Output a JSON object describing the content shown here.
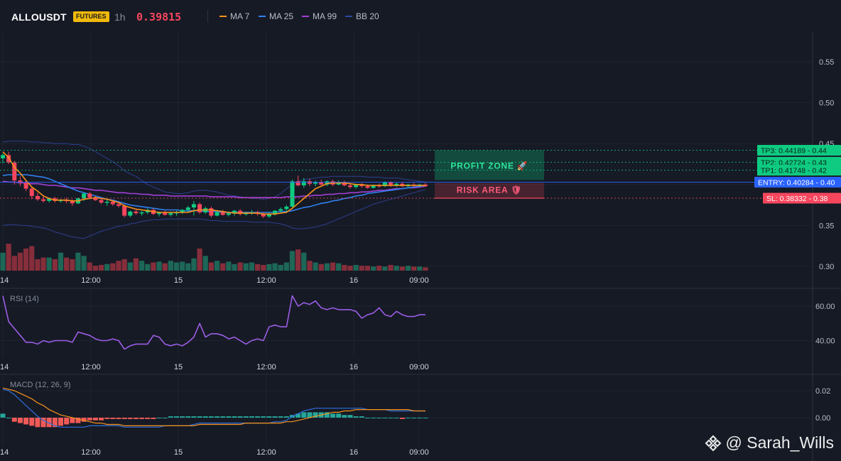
{
  "header": {
    "symbol": "ALLOUSDT",
    "badge": "FUTURES",
    "interval": "1h",
    "price": "0.39815"
  },
  "legend": [
    {
      "label": "MA 7",
      "color": "#f7931a"
    },
    {
      "label": "MA 25",
      "color": "#2f80ed"
    },
    {
      "label": "MA 99",
      "color": "#a23fd6"
    },
    {
      "label": "BB 20",
      "color": "#2d4aa0"
    }
  ],
  "price_axis": {
    "ticks": [
      "0.55",
      "0.50",
      "0.45",
      "0.40",
      "0.35",
      "0.30"
    ]
  },
  "time_axis": {
    "labels": [
      "14",
      "12:00",
      "15",
      "12:00",
      "16",
      "09:00"
    ]
  },
  "levels": [
    {
      "name": "TP3",
      "text": "TP3: 0.44189",
      "axis": "0.44",
      "value": 0.44189,
      "color": "#0ecb81"
    },
    {
      "name": "TP2",
      "text": "TP2: 0.42724",
      "axis": "0.43",
      "value": 0.42724,
      "color": "#0ecb81"
    },
    {
      "name": "TP1",
      "text": "TP1: 0.41748",
      "axis": "0.42",
      "value": 0.41748,
      "color": "#0ecb81"
    },
    {
      "name": "ENTRY",
      "text": "ENTRY: 0.40284",
      "axis": "0.40",
      "value": 0.40284,
      "color": "#2962ff"
    },
    {
      "name": "SL",
      "text": "SL: 0.38332",
      "axis": "0.38",
      "value": 0.38332,
      "color": "#f6465d"
    }
  ],
  "zones": {
    "profit": "PROFIT ZONE 🚀",
    "risk": "RISK AREA 🛡"
  },
  "rsi": {
    "title": "RSI (14)",
    "ticks": [
      "60.00",
      "40.00"
    ]
  },
  "macd": {
    "title": "MACD (12, 26, 9)",
    "ticks": [
      "0.02",
      "0.00"
    ]
  },
  "watermark": "@ Sarah_Wills",
  "colors": {
    "up": "#0ecb81",
    "down": "#f6465d"
  },
  "chart_data": {
    "type": "candlestick",
    "candles": [
      [
        0.432,
        0.438,
        0.426,
        0.436
      ],
      [
        0.436,
        0.44,
        0.425,
        0.427
      ],
      [
        0.427,
        0.429,
        0.4,
        0.405
      ],
      [
        0.405,
        0.41,
        0.398,
        0.402
      ],
      [
        0.402,
        0.405,
        0.392,
        0.395
      ],
      [
        0.395,
        0.397,
        0.382,
        0.386
      ],
      [
        0.386,
        0.39,
        0.38,
        0.382
      ],
      [
        0.382,
        0.385,
        0.378,
        0.38
      ],
      [
        0.38,
        0.384,
        0.378,
        0.383
      ],
      [
        0.383,
        0.385,
        0.378,
        0.38
      ],
      [
        0.38,
        0.382,
        0.378,
        0.381
      ],
      [
        0.381,
        0.384,
        0.377,
        0.38
      ],
      [
        0.38,
        0.382,
        0.374,
        0.377
      ],
      [
        0.377,
        0.384,
        0.376,
        0.383
      ],
      [
        0.383,
        0.39,
        0.38,
        0.389
      ],
      [
        0.389,
        0.391,
        0.383,
        0.384
      ],
      [
        0.384,
        0.386,
        0.38,
        0.381
      ],
      [
        0.381,
        0.383,
        0.376,
        0.378
      ],
      [
        0.378,
        0.382,
        0.374,
        0.379
      ],
      [
        0.379,
        0.381,
        0.374,
        0.376
      ],
      [
        0.376,
        0.378,
        0.372,
        0.374
      ],
      [
        0.374,
        0.376,
        0.36,
        0.362
      ],
      [
        0.362,
        0.368,
        0.36,
        0.367
      ],
      [
        0.367,
        0.369,
        0.363,
        0.365
      ],
      [
        0.365,
        0.368,
        0.362,
        0.366
      ],
      [
        0.366,
        0.371,
        0.364,
        0.369
      ],
      [
        0.369,
        0.371,
        0.363,
        0.364
      ],
      [
        0.364,
        0.367,
        0.361,
        0.366
      ],
      [
        0.366,
        0.368,
        0.362,
        0.363
      ],
      [
        0.363,
        0.367,
        0.361,
        0.365
      ],
      [
        0.365,
        0.368,
        0.362,
        0.366
      ],
      [
        0.366,
        0.37,
        0.364,
        0.369
      ],
      [
        0.369,
        0.374,
        0.366,
        0.372
      ],
      [
        0.372,
        0.38,
        0.362,
        0.376
      ],
      [
        0.376,
        0.378,
        0.364,
        0.366
      ],
      [
        0.366,
        0.373,
        0.364,
        0.371
      ],
      [
        0.371,
        0.373,
        0.36,
        0.362
      ],
      [
        0.362,
        0.368,
        0.361,
        0.366
      ],
      [
        0.366,
        0.369,
        0.362,
        0.363
      ],
      [
        0.363,
        0.367,
        0.361,
        0.365
      ],
      [
        0.365,
        0.369,
        0.362,
        0.368
      ],
      [
        0.368,
        0.37,
        0.362,
        0.364
      ],
      [
        0.364,
        0.367,
        0.362,
        0.365
      ],
      [
        0.365,
        0.369,
        0.363,
        0.366
      ],
      [
        0.366,
        0.368,
        0.362,
        0.364
      ],
      [
        0.364,
        0.366,
        0.359,
        0.361
      ],
      [
        0.361,
        0.366,
        0.359,
        0.364
      ],
      [
        0.364,
        0.369,
        0.362,
        0.368
      ],
      [
        0.368,
        0.372,
        0.366,
        0.37
      ],
      [
        0.37,
        0.375,
        0.367,
        0.373
      ],
      [
        0.373,
        0.406,
        0.372,
        0.404
      ],
      [
        0.404,
        0.411,
        0.398,
        0.399
      ],
      [
        0.399,
        0.408,
        0.396,
        0.404
      ],
      [
        0.404,
        0.407,
        0.398,
        0.401
      ],
      [
        0.401,
        0.405,
        0.398,
        0.403
      ],
      [
        0.403,
        0.406,
        0.399,
        0.4
      ],
      [
        0.4,
        0.405,
        0.398,
        0.404
      ],
      [
        0.404,
        0.406,
        0.398,
        0.4
      ],
      [
        0.4,
        0.405,
        0.399,
        0.403
      ],
      [
        0.403,
        0.405,
        0.398,
        0.399
      ],
      [
        0.399,
        0.402,
        0.395,
        0.397
      ],
      [
        0.397,
        0.401,
        0.395,
        0.4
      ],
      [
        0.4,
        0.402,
        0.396,
        0.398
      ],
      [
        0.398,
        0.4,
        0.395,
        0.396
      ],
      [
        0.396,
        0.4,
        0.395,
        0.399
      ],
      [
        0.399,
        0.401,
        0.396,
        0.398
      ],
      [
        0.398,
        0.404,
        0.397,
        0.403
      ],
      [
        0.403,
        0.404,
        0.397,
        0.399
      ],
      [
        0.399,
        0.402,
        0.397,
        0.401
      ],
      [
        0.401,
        0.403,
        0.397,
        0.398
      ],
      [
        0.398,
        0.401,
        0.396,
        0.4
      ],
      [
        0.4,
        0.402,
        0.397,
        0.399
      ],
      [
        0.399,
        0.401,
        0.397,
        0.4
      ],
      [
        0.4,
        0.402,
        0.397,
        0.398
      ]
    ],
    "volume": [
      22,
      33,
      18,
      22,
      27,
      30,
      14,
      16,
      16,
      14,
      22,
      16,
      14,
      22,
      18,
      10,
      6,
      7,
      8,
      9,
      12,
      14,
      10,
      15,
      12,
      8,
      10,
      11,
      9,
      12,
      10,
      11,
      9,
      15,
      27,
      18,
      10,
      12,
      9,
      11,
      8,
      10,
      9,
      10,
      8,
      7,
      8,
      9,
      7,
      10,
      24,
      26,
      22,
      12,
      10,
      8,
      9,
      10,
      9,
      7,
      6,
      7,
      6,
      6,
      5,
      6,
      5,
      7,
      6,
      5,
      6,
      5,
      5,
      4
    ],
    "ma7": [
      0.44,
      0.433,
      0.421,
      0.414,
      0.405,
      0.397,
      0.392,
      0.386,
      0.383,
      0.381,
      0.381,
      0.381,
      0.38,
      0.38,
      0.382,
      0.383,
      0.384,
      0.383,
      0.382,
      0.38,
      0.378,
      0.374,
      0.372,
      0.37,
      0.369,
      0.368,
      0.367,
      0.366,
      0.366,
      0.366,
      0.366,
      0.366,
      0.366,
      0.368,
      0.369,
      0.369,
      0.369,
      0.368,
      0.367,
      0.366,
      0.365,
      0.365,
      0.365,
      0.365,
      0.365,
      0.364,
      0.364,
      0.364,
      0.365,
      0.366,
      0.371,
      0.377,
      0.383,
      0.389,
      0.395,
      0.398,
      0.401,
      0.402,
      0.402,
      0.402,
      0.401,
      0.4,
      0.4,
      0.399,
      0.399,
      0.399,
      0.399,
      0.399,
      0.399,
      0.399,
      0.399,
      0.399,
      0.399,
      0.399
    ],
    "ma25": [
      0.411,
      0.412,
      0.412,
      0.412,
      0.412,
      0.411,
      0.41,
      0.409,
      0.407,
      0.404,
      0.401,
      0.398,
      0.395,
      0.392,
      0.39,
      0.388,
      0.386,
      0.384,
      0.382,
      0.381,
      0.379,
      0.377,
      0.375,
      0.374,
      0.373,
      0.372,
      0.371,
      0.37,
      0.369,
      0.369,
      0.369,
      0.368,
      0.368,
      0.368,
      0.368,
      0.367,
      0.367,
      0.367,
      0.366,
      0.366,
      0.366,
      0.366,
      0.366,
      0.366,
      0.366,
      0.366,
      0.366,
      0.366,
      0.367,
      0.367,
      0.368,
      0.37,
      0.372,
      0.373,
      0.375,
      0.377,
      0.378,
      0.38,
      0.381,
      0.383,
      0.384,
      0.386,
      0.387,
      0.389,
      0.39,
      0.391,
      0.392,
      0.393,
      0.394,
      0.395,
      0.396,
      0.397,
      0.398,
      0.399
    ],
    "ma99": [
      0.404,
      0.403,
      0.403,
      0.402,
      0.402,
      0.401,
      0.401,
      0.4,
      0.399,
      0.399,
      0.398,
      0.397,
      0.396,
      0.396,
      0.395,
      0.394,
      0.393,
      0.393,
      0.392,
      0.391,
      0.39,
      0.39,
      0.389,
      0.389,
      0.388,
      0.388,
      0.387,
      0.387,
      0.387,
      0.386,
      0.386,
      0.386,
      0.386,
      0.386,
      0.386,
      0.386,
      0.385,
      0.385,
      0.385,
      0.385,
      0.385,
      0.384,
      0.384,
      0.384,
      0.384,
      0.384,
      0.384,
      0.384,
      0.384,
      0.385,
      0.385,
      0.385,
      0.386,
      0.386,
      0.387,
      0.387,
      0.388,
      0.388,
      0.389,
      0.389,
      0.39,
      0.39,
      0.391,
      0.391,
      0.392,
      0.393,
      0.393,
      0.394,
      0.395,
      0.395,
      0.396,
      0.396,
      0.397,
      0.398
    ],
    "bb_upper": [
      0.452,
      0.453,
      0.453,
      0.453,
      0.453,
      0.452,
      0.452,
      0.451,
      0.451,
      0.45,
      0.45,
      0.45,
      0.449,
      0.449,
      0.447,
      0.444,
      0.44,
      0.436,
      0.432,
      0.428,
      0.423,
      0.417,
      0.413,
      0.41,
      0.405,
      0.4,
      0.397,
      0.394,
      0.391,
      0.39,
      0.389,
      0.389,
      0.39,
      0.392,
      0.393,
      0.393,
      0.392,
      0.391,
      0.389,
      0.387,
      0.386,
      0.385,
      0.384,
      0.383,
      0.383,
      0.382,
      0.383,
      0.385,
      0.389,
      0.395,
      0.4,
      0.404,
      0.406,
      0.407,
      0.408,
      0.409,
      0.409,
      0.41,
      0.41,
      0.41,
      0.41,
      0.41,
      0.41,
      0.409,
      0.409,
      0.409,
      0.408,
      0.408,
      0.408,
      0.407,
      0.406,
      0.405,
      0.404,
      0.403
    ],
    "bb_lower": [
      0.35,
      0.351,
      0.351,
      0.35,
      0.35,
      0.349,
      0.348,
      0.347,
      0.345,
      0.342,
      0.34,
      0.338,
      0.336,
      0.335,
      0.334,
      0.337,
      0.34,
      0.343,
      0.345,
      0.347,
      0.349,
      0.35,
      0.352,
      0.353,
      0.355,
      0.356,
      0.357,
      0.357,
      0.358,
      0.358,
      0.358,
      0.358,
      0.358,
      0.358,
      0.358,
      0.357,
      0.356,
      0.356,
      0.355,
      0.355,
      0.355,
      0.355,
      0.355,
      0.354,
      0.354,
      0.354,
      0.354,
      0.353,
      0.352,
      0.35,
      0.347,
      0.346,
      0.346,
      0.347,
      0.348,
      0.35,
      0.352,
      0.355,
      0.358,
      0.361,
      0.364,
      0.367,
      0.37,
      0.373,
      0.376,
      0.378,
      0.38,
      0.382,
      0.384,
      0.386,
      0.388,
      0.39,
      0.392,
      0.394
    ],
    "rsi": [
      66,
      51,
      47,
      43,
      39,
      39,
      38,
      40,
      39,
      40,
      40,
      40,
      39,
      45,
      44,
      43,
      41,
      40,
      40,
      41,
      40,
      35,
      37,
      38,
      38,
      38,
      43,
      42,
      38,
      37,
      38,
      37,
      39,
      42,
      50,
      42,
      44,
      44,
      43,
      41,
      42,
      40,
      38,
      40,
      41,
      40,
      48,
      49,
      48,
      48,
      66,
      60,
      62,
      61,
      63,
      59,
      58,
      59,
      58,
      58,
      58,
      57,
      53,
      55,
      56,
      59,
      55,
      54,
      57,
      55,
      54,
      54,
      55,
      55
    ],
    "macd_line": [
      0.021,
      0.02,
      0.017,
      0.013,
      0.009,
      0.005,
      0.001,
      -0.002,
      -0.004,
      -0.006,
      -0.007,
      -0.007,
      -0.007,
      -0.007,
      -0.007,
      -0.006,
      -0.006,
      -0.006,
      -0.006,
      -0.006,
      -0.006,
      -0.007,
      -0.007,
      -0.007,
      -0.007,
      -0.007,
      -0.007,
      -0.007,
      -0.006,
      -0.006,
      -0.006,
      -0.006,
      -0.006,
      -0.005,
      -0.004,
      -0.004,
      -0.004,
      -0.004,
      -0.004,
      -0.004,
      -0.004,
      -0.004,
      -0.004,
      -0.004,
      -0.004,
      -0.004,
      -0.004,
      -0.003,
      -0.003,
      -0.002,
      0.001,
      0.003,
      0.005,
      0.006,
      0.007,
      0.007,
      0.007,
      0.007,
      0.007,
      0.007,
      0.007,
      0.007,
      0.007,
      0.006,
      0.006,
      0.006,
      0.006,
      0.005,
      0.005,
      0.005,
      0.005,
      0.005,
      0.005,
      0.005
    ],
    "macd_signal": [
      0.022,
      0.021,
      0.02,
      0.018,
      0.016,
      0.014,
      0.011,
      0.009,
      0.006,
      0.004,
      0.002,
      0.001,
      0.0,
      -0.001,
      -0.002,
      -0.003,
      -0.004,
      -0.004,
      -0.005,
      -0.005,
      -0.005,
      -0.006,
      -0.006,
      -0.006,
      -0.006,
      -0.006,
      -0.006,
      -0.006,
      -0.006,
      -0.006,
      -0.006,
      -0.006,
      -0.006,
      -0.006,
      -0.005,
      -0.005,
      -0.005,
      -0.005,
      -0.005,
      -0.005,
      -0.005,
      -0.005,
      -0.004,
      -0.004,
      -0.004,
      -0.004,
      -0.004,
      -0.004,
      -0.004,
      -0.003,
      -0.003,
      -0.002,
      -0.001,
      0.0,
      0.001,
      0.002,
      0.003,
      0.004,
      0.004,
      0.005,
      0.005,
      0.006,
      0.006,
      0.006,
      0.006,
      0.006,
      0.006,
      0.006,
      0.006,
      0.006,
      0.006,
      0.005,
      0.005,
      0.005
    ],
    "macd_hist": [
      0.003,
      0.0,
      -0.003,
      -0.004,
      -0.005,
      -0.006,
      -0.007,
      -0.007,
      -0.007,
      -0.007,
      -0.006,
      -0.005,
      -0.004,
      -0.004,
      -0.003,
      -0.002,
      -0.002,
      -0.002,
      -0.001,
      -0.001,
      -0.001,
      -0.001,
      -0.001,
      -0.001,
      -0.001,
      -0.001,
      -0.001,
      0.0,
      0.0,
      0.001,
      0.001,
      0.001,
      0.001,
      0.001,
      0.001,
      0.001,
      0.001,
      0.001,
      0.001,
      0.001,
      0.001,
      0.001,
      0.001,
      0.001,
      0.001,
      0.001,
      0.001,
      0.001,
      0.001,
      0.001,
      0.002,
      0.003,
      0.004,
      0.004,
      0.004,
      0.004,
      0.004,
      0.003,
      0.003,
      0.002,
      0.002,
      0.001,
      0.001,
      0.0,
      0.0,
      0.0,
      0.0,
      0.0,
      0.0,
      -0.001,
      0.0,
      0.0,
      0.0,
      0.0
    ]
  }
}
